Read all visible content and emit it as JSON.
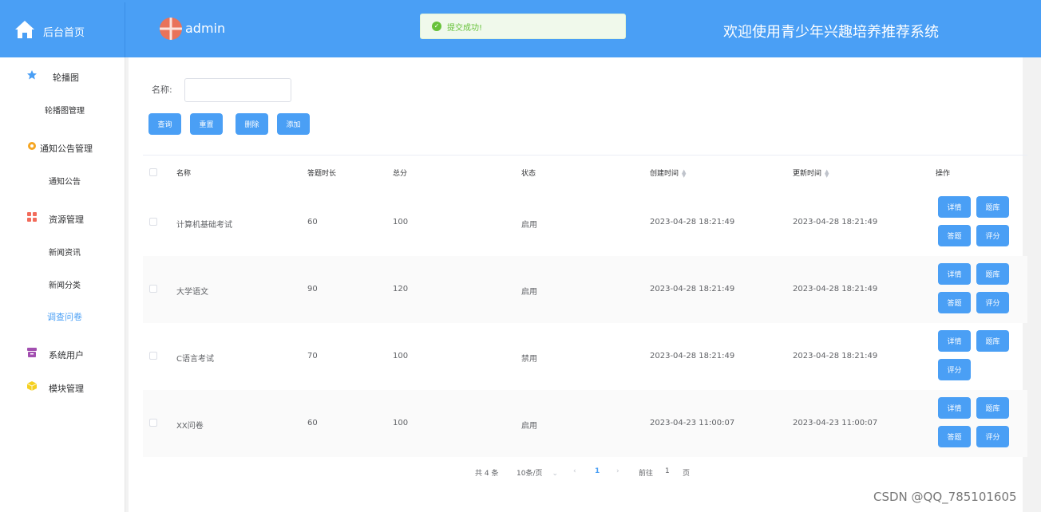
{
  "header": {
    "home_label": "后台首页",
    "user_name": "admin",
    "site_title": "欢迎使用青少年兴趣培养推荐系统"
  },
  "toast": {
    "message": "提交成功!"
  },
  "sidebar": {
    "items": [
      {
        "label": "轮播图",
        "icon": "star-icon",
        "color": "#4a9ff5"
      },
      {
        "label": "轮播图管理"
      },
      {
        "label": "通知公告管理",
        "icon": "gear-icon",
        "color": "#f5a623"
      },
      {
        "label": "通知公告"
      },
      {
        "label": "资源管理",
        "icon": "grid-icon",
        "color": "#f26b5b"
      },
      {
        "label": "新闻资讯"
      },
      {
        "label": "新闻分类"
      },
      {
        "label": "调查问卷",
        "active": true
      },
      {
        "label": "系统用户",
        "icon": "archive-icon",
        "color": "#a24fb0"
      },
      {
        "label": "模块管理",
        "icon": "cube-icon",
        "color": "#f5d020"
      }
    ]
  },
  "search": {
    "name_label": "名称:",
    "name_value": ""
  },
  "toolbar": {
    "query": "查询",
    "reset": "重置",
    "delete": "删除",
    "add": "添加"
  },
  "table": {
    "columns": [
      "名称",
      "答题时长",
      "总分",
      "状态",
      "创建时间",
      "更新时间",
      "操作"
    ],
    "rows": [
      {
        "name": "计算机基础考试",
        "duration": "60",
        "score": "100",
        "status": "启用",
        "created": "2023-04-28 18:21:49",
        "updated": "2023-04-28 18:21:49"
      },
      {
        "name": "大学语文",
        "duration": "90",
        "score": "120",
        "status": "启用",
        "created": "2023-04-28 18:21:49",
        "updated": "2023-04-28 18:21:49"
      },
      {
        "name": "C语言考试",
        "duration": "70",
        "score": "100",
        "status": "禁用",
        "created": "2023-04-28 18:21:49",
        "updated": "2023-04-28 18:21:49"
      },
      {
        "name": "XX问卷",
        "duration": "60",
        "score": "100",
        "status": "启用",
        "created": "2023-04-23 11:00:07",
        "updated": "2023-04-23 11:00:07"
      }
    ],
    "actions": {
      "detail": "详情",
      "bank": "题库",
      "answer": "答题",
      "grade": "评分"
    }
  },
  "pagination": {
    "total": "共 4 条",
    "page_size": "10条/页",
    "current_page": "1",
    "goto_prefix": "前往",
    "goto_value": "1",
    "goto_suffix": "页"
  },
  "watermark": "CSDN @QQ_785101605",
  "colors": {
    "primary": "#4a9ff5",
    "success": "#67c23a"
  }
}
